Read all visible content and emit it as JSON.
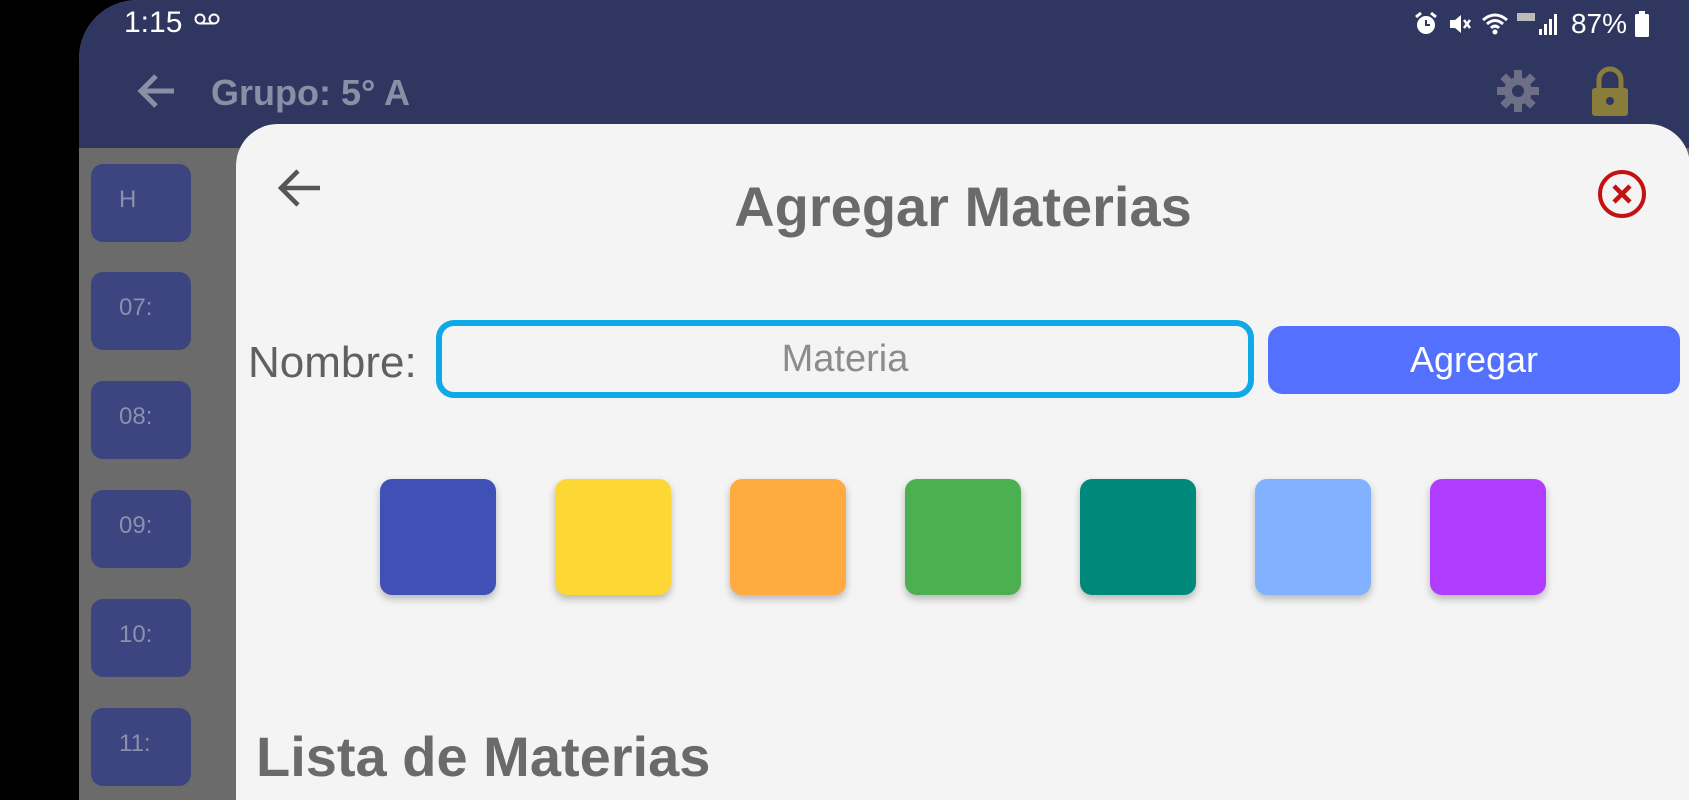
{
  "status_bar": {
    "time": "1:15",
    "battery": "87%",
    "icons": [
      "voicemail-icon",
      "alarm-icon",
      "mute-icon",
      "wifi-icon",
      "signal-icon",
      "battery-icon"
    ]
  },
  "app_bar": {
    "title": "Grupo: 5° A",
    "icons": [
      "back-arrow-icon",
      "gear-icon",
      "lock-icon"
    ]
  },
  "background_rows": [
    {
      "time": "H"
    },
    {
      "time": "07:"
    },
    {
      "time": "08:"
    },
    {
      "time": "09:"
    },
    {
      "time": "10:"
    },
    {
      "time": "11:"
    }
  ],
  "background_row_colors": [
    "#3c4580",
    "#3c4580",
    "#3c4580",
    "#3c4580",
    "#3c4580",
    "#3c4580"
  ],
  "background_right_colors": [
    "#3c4580",
    "#7a5a3a",
    "#7a5a3a",
    "#4d5a7a",
    "#444444",
    "#444444"
  ],
  "dialog": {
    "title": "Agregar Materias",
    "name_label": "Nombre:",
    "name_input": {
      "value": "",
      "placeholder": "Materia"
    },
    "add_button": "Agregar",
    "swatches": [
      "#3f51b5",
      "#fdd835",
      "#ffab40",
      "#4caf50",
      "#00897b",
      "#82b1ff",
      "#b03cff"
    ],
    "list_title": "Lista de Materias",
    "accent": "#5470ff",
    "focus_color": "#0ea9e6",
    "close_color": "#c41212"
  }
}
